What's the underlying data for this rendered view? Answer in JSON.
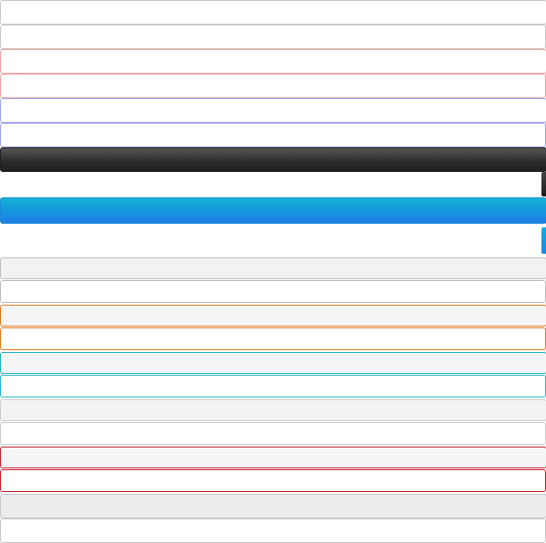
{
  "bars": [
    {
      "name": "gray-bar",
      "border_color": "#c8c8c8",
      "fill": "#ffffff"
    },
    {
      "name": "pink-bar",
      "border_color": "#f4a3a3",
      "fill": "#ffffff"
    },
    {
      "name": "blue-bar",
      "border_color": "#9fa6ef",
      "fill": "#ffffff"
    },
    {
      "name": "dark-gradient-bar",
      "border_color": "#222222",
      "fill": "#2b2b2b"
    },
    {
      "name": "cyan-gradient-bar",
      "border_color": "#1a8ad6",
      "fill": "#1596df"
    },
    {
      "name": "light-gray-bar",
      "border_color": "#bdbdbd",
      "fill": "#f2f2f2"
    },
    {
      "name": "orange-bar",
      "border_color": "#e57a1e",
      "fill": "#f5f5f5"
    },
    {
      "name": "teal-bar",
      "border_color": "#29b4c8",
      "fill": "#f5f5f5"
    },
    {
      "name": "pale-gray-bar",
      "border_color": "#cccccc",
      "fill": "#f3f3f3"
    },
    {
      "name": "red-bar",
      "border_color": "#c8202a",
      "fill": "#f5f5f5"
    },
    {
      "name": "gray-filled-bar",
      "border_color": "#c8c8c8",
      "fill": "#ececec"
    }
  ]
}
